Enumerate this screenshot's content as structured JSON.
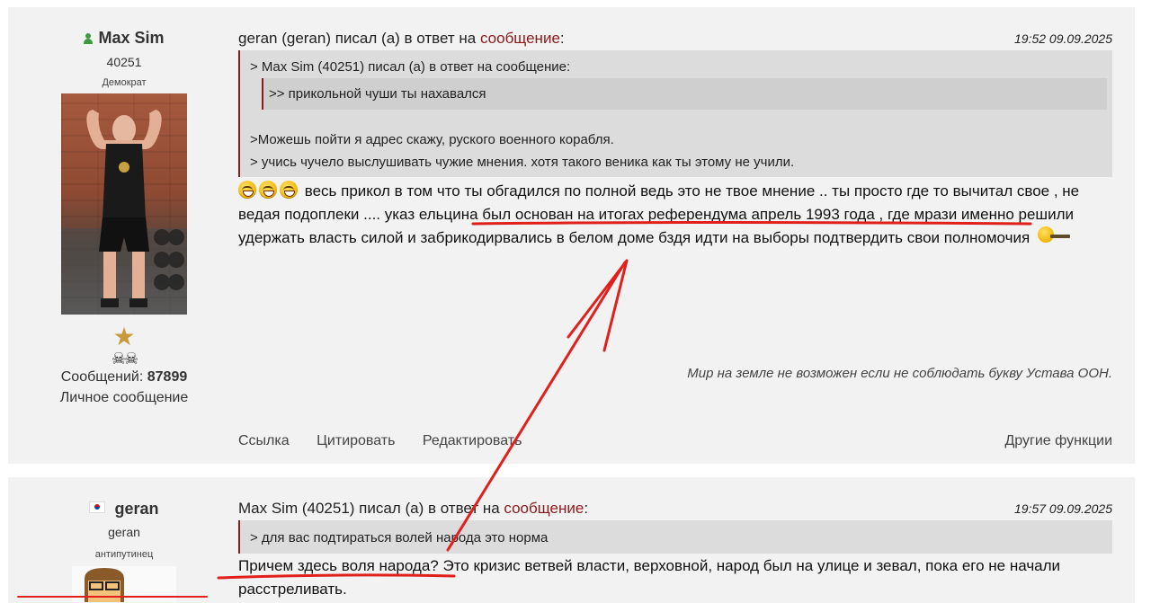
{
  "posts": [
    {
      "user": {
        "name": "Max Sim",
        "id": "40251",
        "rank": "Демократ",
        "messages_label": "Сообщений:",
        "messages_count": "87899",
        "pm_label": "Личное сообщение"
      },
      "header": {
        "prefix": "geran (geran) писал (а) в ответ на ",
        "link": "сообщение",
        "suffix": ":",
        "timestamp": "19:52 09.09.2025"
      },
      "quote": {
        "line1": "> Max Sim (40251) писал (а) в ответ на сообщение:",
        "inner": ">> прикольной чуши ты нахавался",
        "line2": ">Можешь пойти я адрес скажу, руского военного корабля.",
        "line3": "> учись чучело выслушивать чужие мнения. хотя такого веника как ты этому не учили."
      },
      "body": {
        "part1": "весь прикол в том что ты обгадился по полной ведь это не твое мнение .. ты просто где то вычитал свое , не ведая подоплеки .... ",
        "highlight": "указ ельцина был основан на итогах референдума апрель 1993 года ",
        "part2": ", где мрази именно решили удержать власть силой и забрикодирвались в белом доме бздя идти на выборы подтвердить свои полномочия"
      },
      "signature": "Мир на земле не возможен если не соблюдать букву Устава ООН.",
      "footer": {
        "link": "Ссылка",
        "quote": "Цитировать",
        "edit": "Редактировать",
        "more": "Другие функции"
      }
    },
    {
      "user": {
        "name": "geran",
        "id": "geran",
        "rank": "антипутинец"
      },
      "header": {
        "prefix": "Max Sim (40251) писал (а) в ответ на ",
        "link": "сообщение",
        "suffix": ":",
        "timestamp": "19:57 09.09.2025"
      },
      "quote": {
        "line1": "> для вас подтираться волей народа это норма"
      },
      "body": {
        "highlight": "Причем здесь воля народа",
        "rest": "? Это кризис ветвей власти, верховной, народ был на улице и зевал, пока его не начали расстреливать."
      }
    }
  ],
  "annotation_color": "#e0201c"
}
